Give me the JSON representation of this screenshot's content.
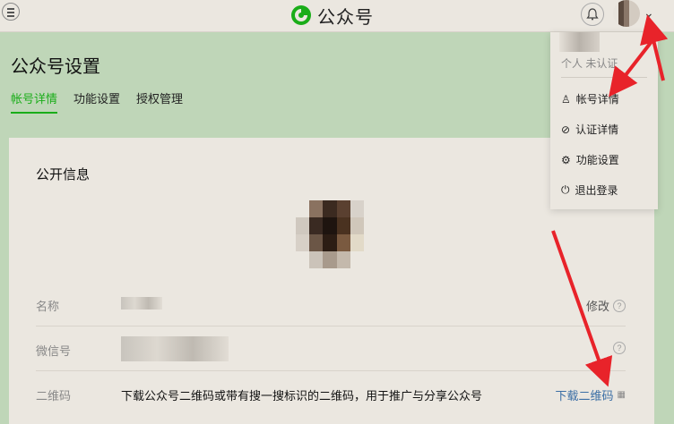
{
  "header": {
    "brand": "公众号",
    "brand_color": "#1aad19",
    "icons": [
      "menu-icon",
      "wechat-logo-icon",
      "bell-icon",
      "chevron-down-icon"
    ]
  },
  "page": {
    "title": "公众号设置",
    "tabs": [
      {
        "label": "帐号详情",
        "active": true
      },
      {
        "label": "功能设置",
        "active": false
      },
      {
        "label": "授权管理",
        "active": false
      }
    ]
  },
  "card": {
    "section_title": "公开信息",
    "rows": [
      {
        "label": "名称",
        "value": "",
        "action": "修改"
      },
      {
        "label": "微信号",
        "value": "",
        "action": ""
      },
      {
        "label": "二维码",
        "value": "下载公众号二维码或带有搜一搜标识的二维码，用于推广与分享公众号",
        "action": "下载二维码"
      }
    ]
  },
  "dropdown": {
    "status": "个人  未认证",
    "items": [
      {
        "label": "帐号详情",
        "icon": "user-icon"
      },
      {
        "label": "认证详情",
        "icon": "check-circle-icon"
      },
      {
        "label": "功能设置",
        "icon": "gear-icon"
      },
      {
        "label": "退出登录",
        "icon": "power-icon"
      }
    ]
  },
  "annotation_color": "#e8232a"
}
